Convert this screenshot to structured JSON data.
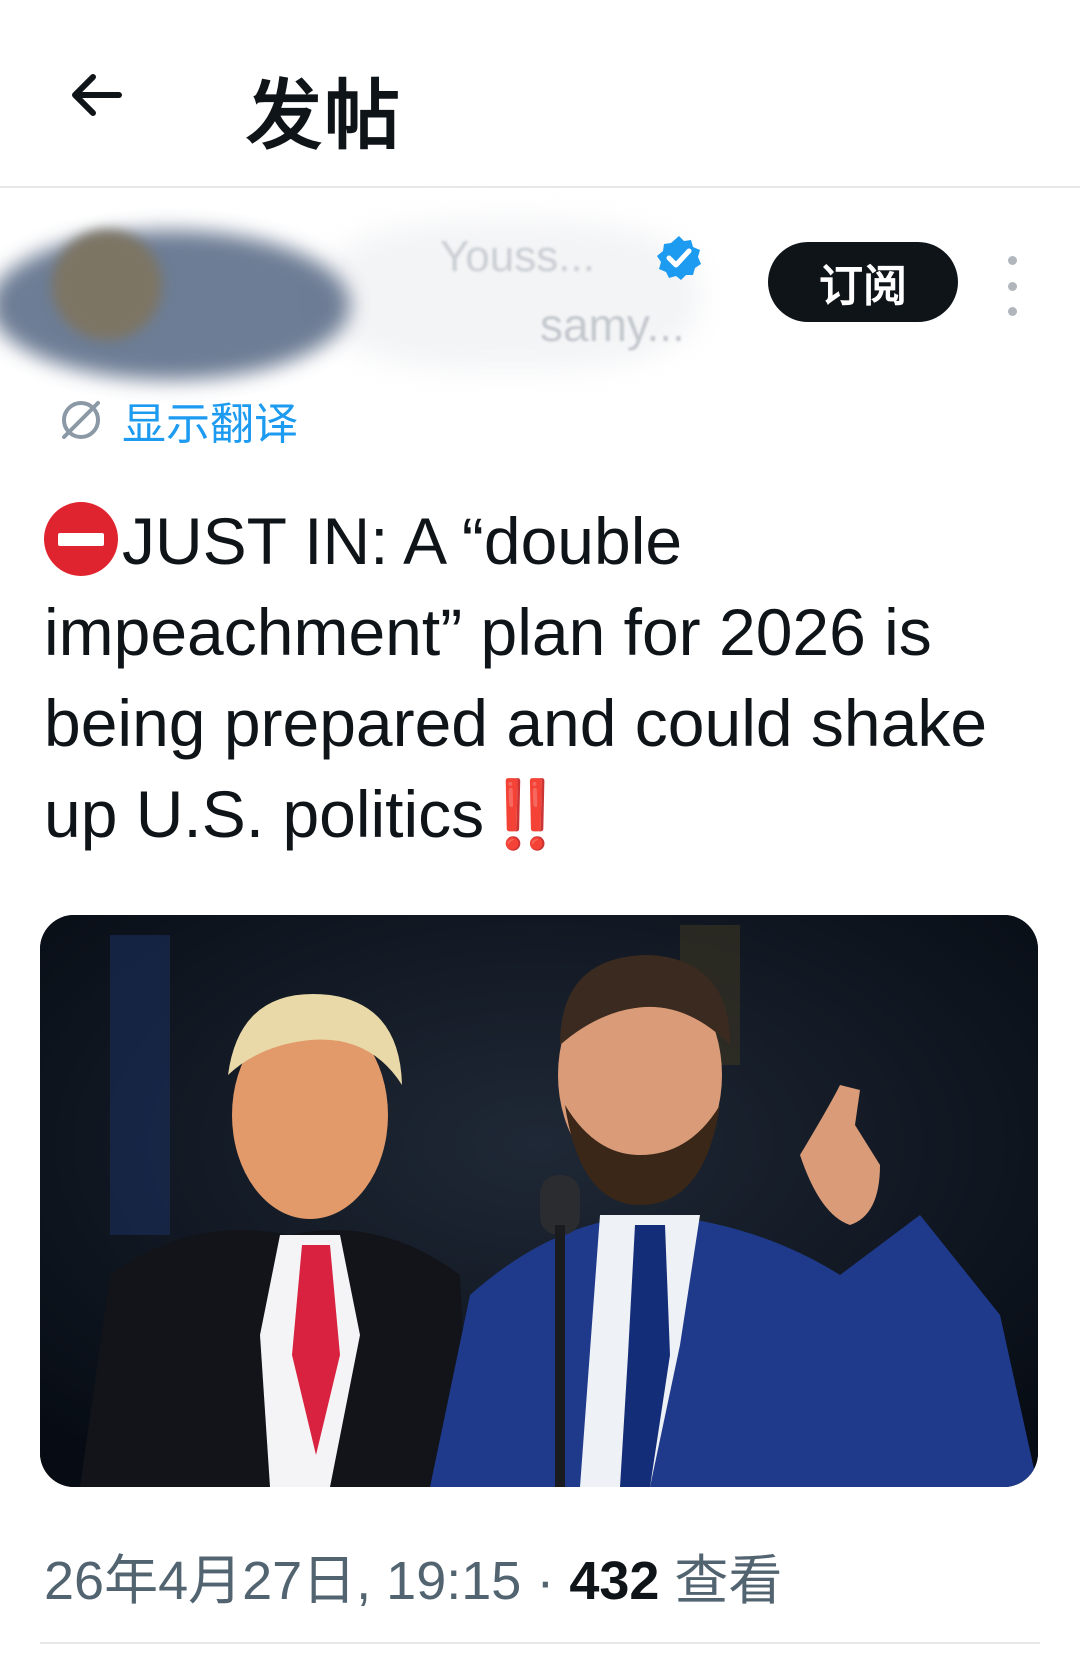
{
  "header": {
    "title": "发帖",
    "back_icon": "arrow-left-icon"
  },
  "author": {
    "display_name": "Youss...",
    "handle": "samy...",
    "verified_icon": "verified-badge-icon",
    "verified_color": "#1d9bf0",
    "subscribe_label": "订阅",
    "more_icon": "vertical-ellipsis-icon"
  },
  "translate": {
    "label": "显示翻译",
    "icon": "globe-icon",
    "color": "#1d9bf0"
  },
  "tweet": {
    "leading_emoji": "no-entry-emoji",
    "text": "JUST IN: A “double impeachment” plan for 2026 is being prepared and could shake up U.S. politics",
    "trailing_emoji": "‼️"
  },
  "media": {
    "type": "photo",
    "alt": "Two men in suits at a podium with a microphone at night"
  },
  "meta": {
    "date": "26年4月27日, 19:15",
    "separator": " · ",
    "views_count": "432",
    "views_label": " 查看"
  },
  "colors": {
    "accent": "#1d9bf0",
    "text": "#0f1419",
    "muted": "#536471",
    "danger": "#e0242f"
  }
}
